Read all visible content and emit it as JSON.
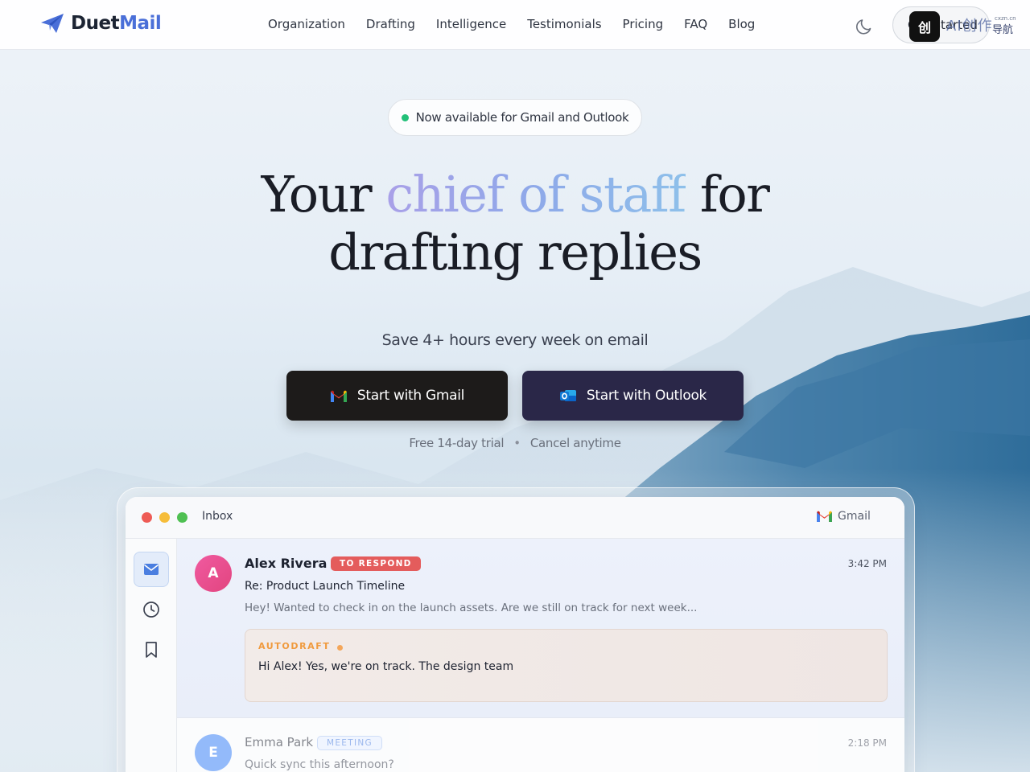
{
  "brand": {
    "name_part1": "Duet",
    "name_part2": "Mail"
  },
  "nav": {
    "links": [
      "Organization",
      "Drafting",
      "Intelligence",
      "Testimonials",
      "Pricing",
      "FAQ",
      "Blog"
    ],
    "cta_label": "Get Started",
    "theme_icon": "moon-icon"
  },
  "watermark": {
    "badge": "创",
    "text": "AI创作",
    "sub": "导航",
    "small": "cxzn.cn"
  },
  "hero": {
    "badge_text": "Now available for Gmail and Outlook",
    "headline_pre": "Your ",
    "headline_highlight": "chief of staff",
    "headline_post": " for",
    "headline_line2": "drafting replies",
    "subtitle": "Save 4+ hours every week on email",
    "btn_gmail": "Start with Gmail",
    "btn_outlook": "Start with Outlook",
    "trial_left": "Free 14-day trial",
    "trial_sep": "•",
    "trial_right": "Cancel anytime"
  },
  "inbox": {
    "title": "Inbox",
    "provider": "Gmail",
    "sidebar": [
      "mail-icon",
      "clock-icon",
      "bookmark-icon"
    ],
    "emails": [
      {
        "initial": "A",
        "sender": "Alex Rivera",
        "tag": "TO RESPOND",
        "time": "3:42 PM",
        "subject": "Re: Product Launch Timeline",
        "preview": "Hey! Wanted to check in on the launch assets. Are we still on track for next week...",
        "draft_label": "AUTODRAFT",
        "draft_text": "Hi Alex! Yes, we're on track. The design team"
      },
      {
        "initial": "E",
        "sender": "Emma Park",
        "tag": "MEETING",
        "time": "2:18 PM",
        "subject": "Quick sync this afternoon?"
      }
    ]
  },
  "colors": {
    "accent": "#4a6fd8",
    "gmail_button": "#1d1b1a",
    "outlook_button": "#2a2748",
    "respond_tag": "#e45c5c",
    "status_dot": "#22c078",
    "autodraft": "#f09a3e"
  }
}
